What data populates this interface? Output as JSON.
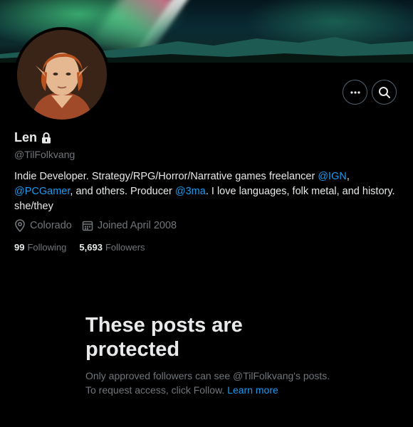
{
  "profile": {
    "display_name": "Len",
    "handle": "@TilFolkvang",
    "bio": {
      "part1": "Indie Developer. Strategy/RPG/Horror/Narrative games freelancer ",
      "mention1": "@IGN",
      "part2": ",",
      "mention2": "@PCGamer",
      "part3": ", and others. Producer ",
      "mention3": "@3ma",
      "part4": ". I love languages, folk metal, and history. she/they"
    },
    "location": "Colorado",
    "joined": "Joined April 2008",
    "following_count": "99",
    "following_label": "Following",
    "followers_count": "5,693",
    "followers_label": "Followers"
  },
  "protected_notice": {
    "title": "These posts are protected",
    "text": "Only approved followers can see @TilFolkvang's posts. To request access, click Follow.",
    "link": "Learn more"
  },
  "icons": {
    "lock": "lock-icon",
    "more": "more-icon",
    "search": "search-icon",
    "location": "location-icon",
    "calendar": "calendar-icon"
  },
  "colors": {
    "background": "#000000",
    "text": "#e7e9ea",
    "secondary": "#71767b",
    "accent": "#1d9bf0"
  }
}
